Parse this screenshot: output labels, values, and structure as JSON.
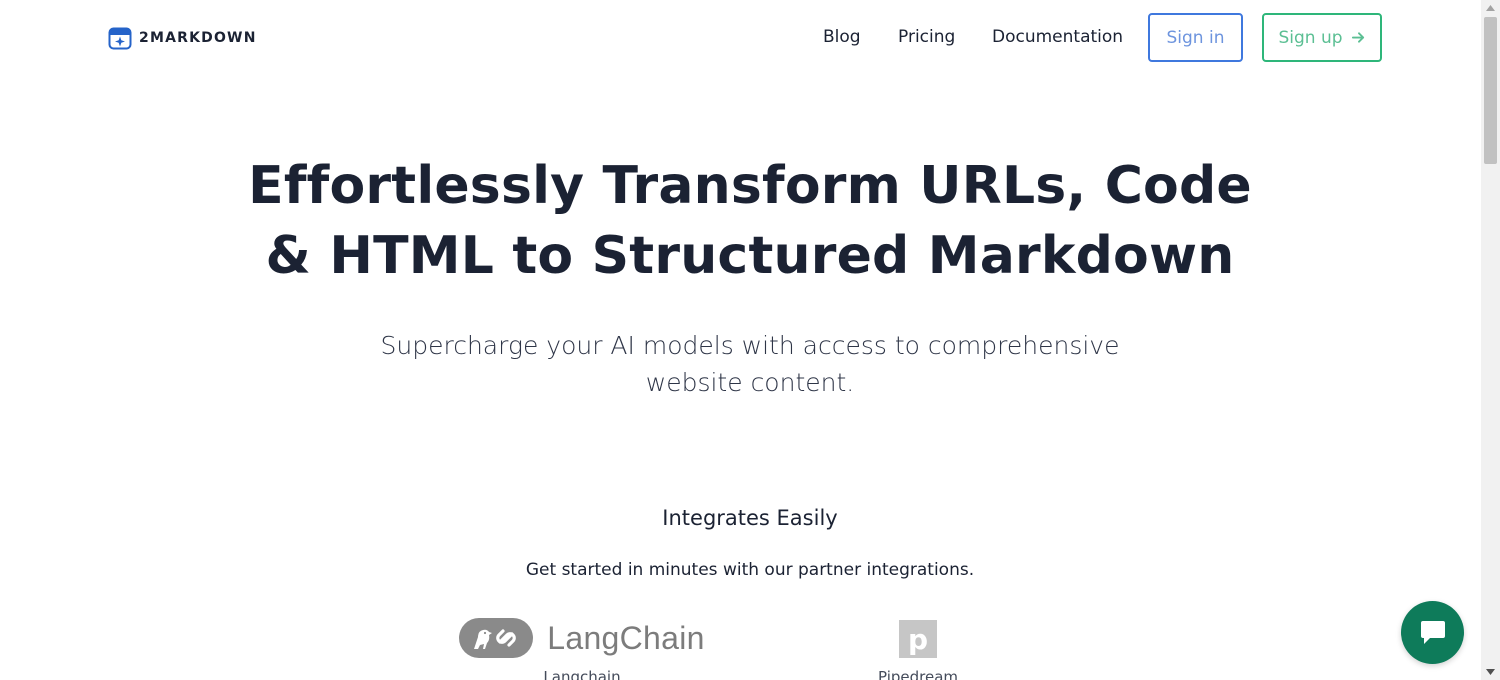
{
  "header": {
    "brand_name": "2MARKDOWN",
    "nav": {
      "blog": "Blog",
      "pricing": "Pricing",
      "documentation": "Documentation"
    },
    "sign_in_label": "Sign in",
    "sign_up_label": "Sign up"
  },
  "hero": {
    "title_line1": "Effortlessly Transform URLs, Code",
    "title_line2": "& HTML to Structured Markdown",
    "subtitle_line1": "Supercharge your AI models with access to comprehensive",
    "subtitle_line2": "website content."
  },
  "integrations": {
    "heading": "Integrates Easily",
    "text": "Get started in minutes with our partner integrations.",
    "partners": [
      {
        "logo_text": "LangChain",
        "label": "Langchain"
      },
      {
        "logo_text": "p",
        "label": "Pipedream"
      }
    ]
  },
  "colors": {
    "brand_blue": "#2563c9",
    "sign_in_border": "#3f78de",
    "sign_up_border": "#2eb67a",
    "chat_green": "#0e7b5a",
    "text_dark": "#1b2233"
  },
  "icons": {
    "brand": "calendar-sparkle-icon",
    "sign_up_arrow": "arrow-right-icon",
    "chat": "chat-bubble-icon",
    "langchain": "parrot-link-icon"
  }
}
